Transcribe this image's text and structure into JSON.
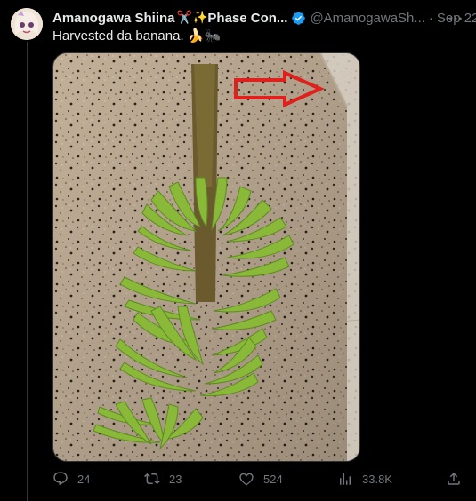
{
  "tweet": {
    "author_name": "Amanogawa Shiina",
    "name_emoji": "✂️✨",
    "name_suffix": "Phase Con...",
    "handle": "@AmanogawaSh...",
    "separator": "·",
    "date": "Sep 22",
    "text": "Harvested da banana. 🍌🐜",
    "verified": true
  },
  "media": {
    "annotation_arrow_color": "#e0201c"
  },
  "actions": {
    "replies": "24",
    "retweets": "23",
    "likes": "524",
    "views": "33.8K"
  },
  "icons": [
    "more-icon",
    "verified-icon",
    "reply-icon",
    "retweet-icon",
    "like-icon",
    "views-icon",
    "share-icon"
  ],
  "colors": {
    "background": "#000000",
    "text": "#e7e9ea",
    "muted": "#71767b",
    "verified": "#1d9bf0"
  }
}
